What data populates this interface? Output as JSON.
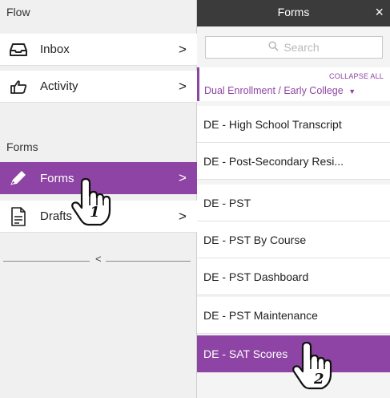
{
  "left": {
    "flow_header": "Flow",
    "flow_items": [
      {
        "label": "Inbox",
        "icon": "inbox-icon",
        "chevron": ">"
      },
      {
        "label": "Activity",
        "icon": "hand-pointer-icon",
        "chevron": ">"
      }
    ],
    "forms_header": "Forms",
    "forms_items": [
      {
        "label": "Forms",
        "icon": "pencil-icon",
        "chevron": ">",
        "active": true
      },
      {
        "label": "Drafts",
        "icon": "document-icon",
        "chevron": ">"
      }
    ],
    "collapse_arrow": "<"
  },
  "right": {
    "title": "Forms",
    "close": "×",
    "search_placeholder": "Search",
    "collapse_all": "COLLAPSE ALL",
    "group_name": "Dual Enrollment / Early College",
    "group_caret": "▼",
    "items": [
      "DE - High School Transcript",
      "DE - Post-Secondary Resi...",
      "DE - PST",
      "DE - PST By Course",
      "DE - PST Dashboard",
      "DE - PST Maintenance",
      "DE - SAT Scores"
    ],
    "selected_index": 6
  },
  "annotations": {
    "step1": "1",
    "step2": "2"
  },
  "colors": {
    "accent": "#8e44a4",
    "header_dark": "#3b3b3b",
    "pane_bg": "#f0f0f0"
  }
}
